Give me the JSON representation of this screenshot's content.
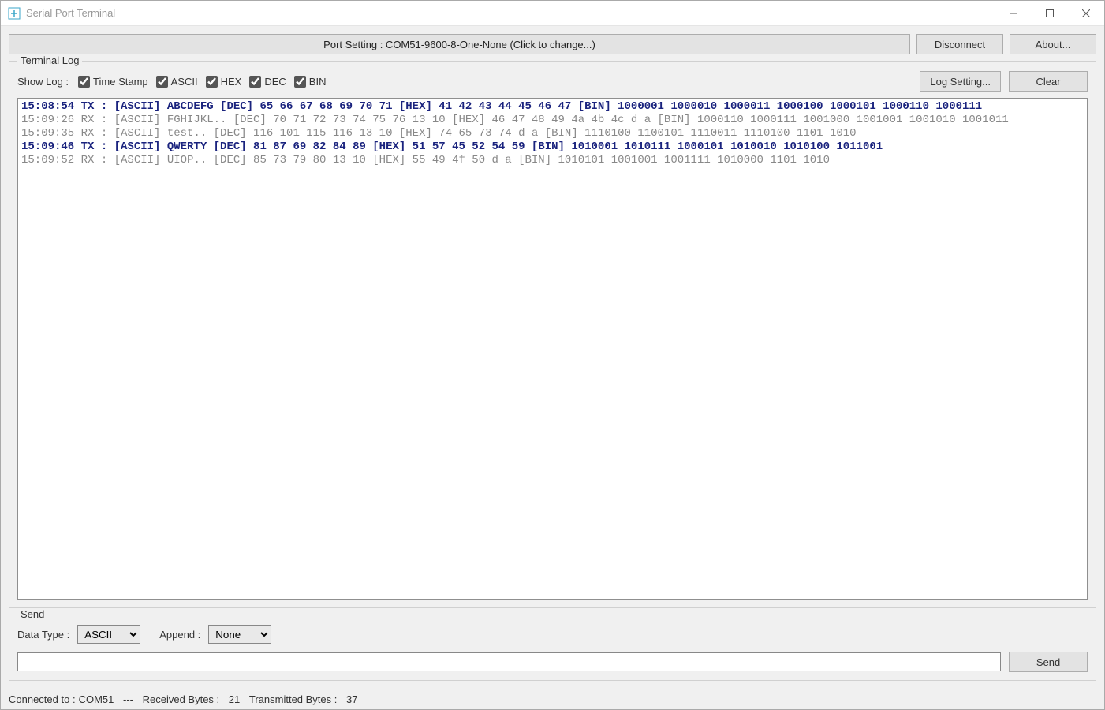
{
  "window": {
    "title": "Serial Port Terminal"
  },
  "toolbar": {
    "port_setting": "Port Setting : COM51-9600-8-One-None (Click to change...)",
    "disconnect": "Disconnect",
    "about": "About..."
  },
  "terminal": {
    "legend": "Terminal Log",
    "show_log_label": "Show Log :",
    "checks": {
      "timestamp": "Time Stamp",
      "ascii": "ASCII",
      "hex": "HEX",
      "dec": "DEC",
      "bin": "BIN"
    },
    "log_setting": "Log Setting...",
    "clear": "Clear",
    "lines": [
      {
        "dir": "tx",
        "text": "15:08:54 TX : [ASCII] ABCDEFG [DEC] 65 66 67 68 69 70 71 [HEX] 41 42 43 44 45 46 47 [BIN] 1000001 1000010 1000011 1000100 1000101 1000110 1000111"
      },
      {
        "dir": "rx",
        "text": "15:09:26 RX : [ASCII] FGHIJKL.. [DEC] 70 71 72 73 74 75 76 13 10 [HEX] 46 47 48 49 4a 4b 4c d a [BIN] 1000110 1000111 1001000 1001001 1001010 1001011"
      },
      {
        "dir": "rx",
        "text": "15:09:35 RX : [ASCII] test.. [DEC] 116 101 115 116 13 10 [HEX] 74 65 73 74 d a [BIN] 1110100 1100101 1110011 1110100 1101 1010"
      },
      {
        "dir": "tx",
        "text": "15:09:46 TX : [ASCII] QWERTY [DEC] 81 87 69 82 84 89 [HEX] 51 57 45 52 54 59 [BIN] 1010001 1010111 1000101 1010010 1010100 1011001"
      },
      {
        "dir": "rx",
        "text": "15:09:52 RX : [ASCII] UIOP.. [DEC] 85 73 79 80 13 10 [HEX] 55 49 4f 50 d a [BIN] 1010101 1001001 1001111 1010000 1101 1010"
      }
    ]
  },
  "send": {
    "legend": "Send",
    "data_type_label": "Data Type :",
    "data_type_value": "ASCII",
    "append_label": "Append :",
    "append_value": "None",
    "send_button": "Send",
    "input_value": ""
  },
  "status": {
    "connected_label": "Connected to :",
    "connected_value": "COM51",
    "sep": "---",
    "received_label": "Received Bytes :",
    "received_value": "21",
    "transmitted_label": "Transmitted Bytes :",
    "transmitted_value": "37"
  }
}
